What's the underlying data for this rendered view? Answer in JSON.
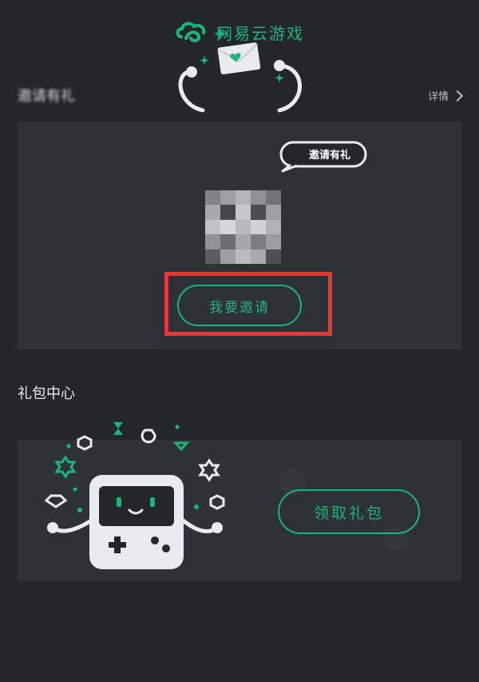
{
  "header": {
    "brand_name": "网易云游戏"
  },
  "invite_section": {
    "title": "邀请有礼",
    "detail_label": "详情",
    "bubble_text": "邀请有礼",
    "button_label": "我要邀请"
  },
  "gift_section": {
    "title": "礼包中心",
    "button_label": "领取礼包"
  },
  "colors": {
    "accent": "#1fb27a",
    "background": "#23272c",
    "card": "#2d3238",
    "highlight": "#e53935"
  }
}
